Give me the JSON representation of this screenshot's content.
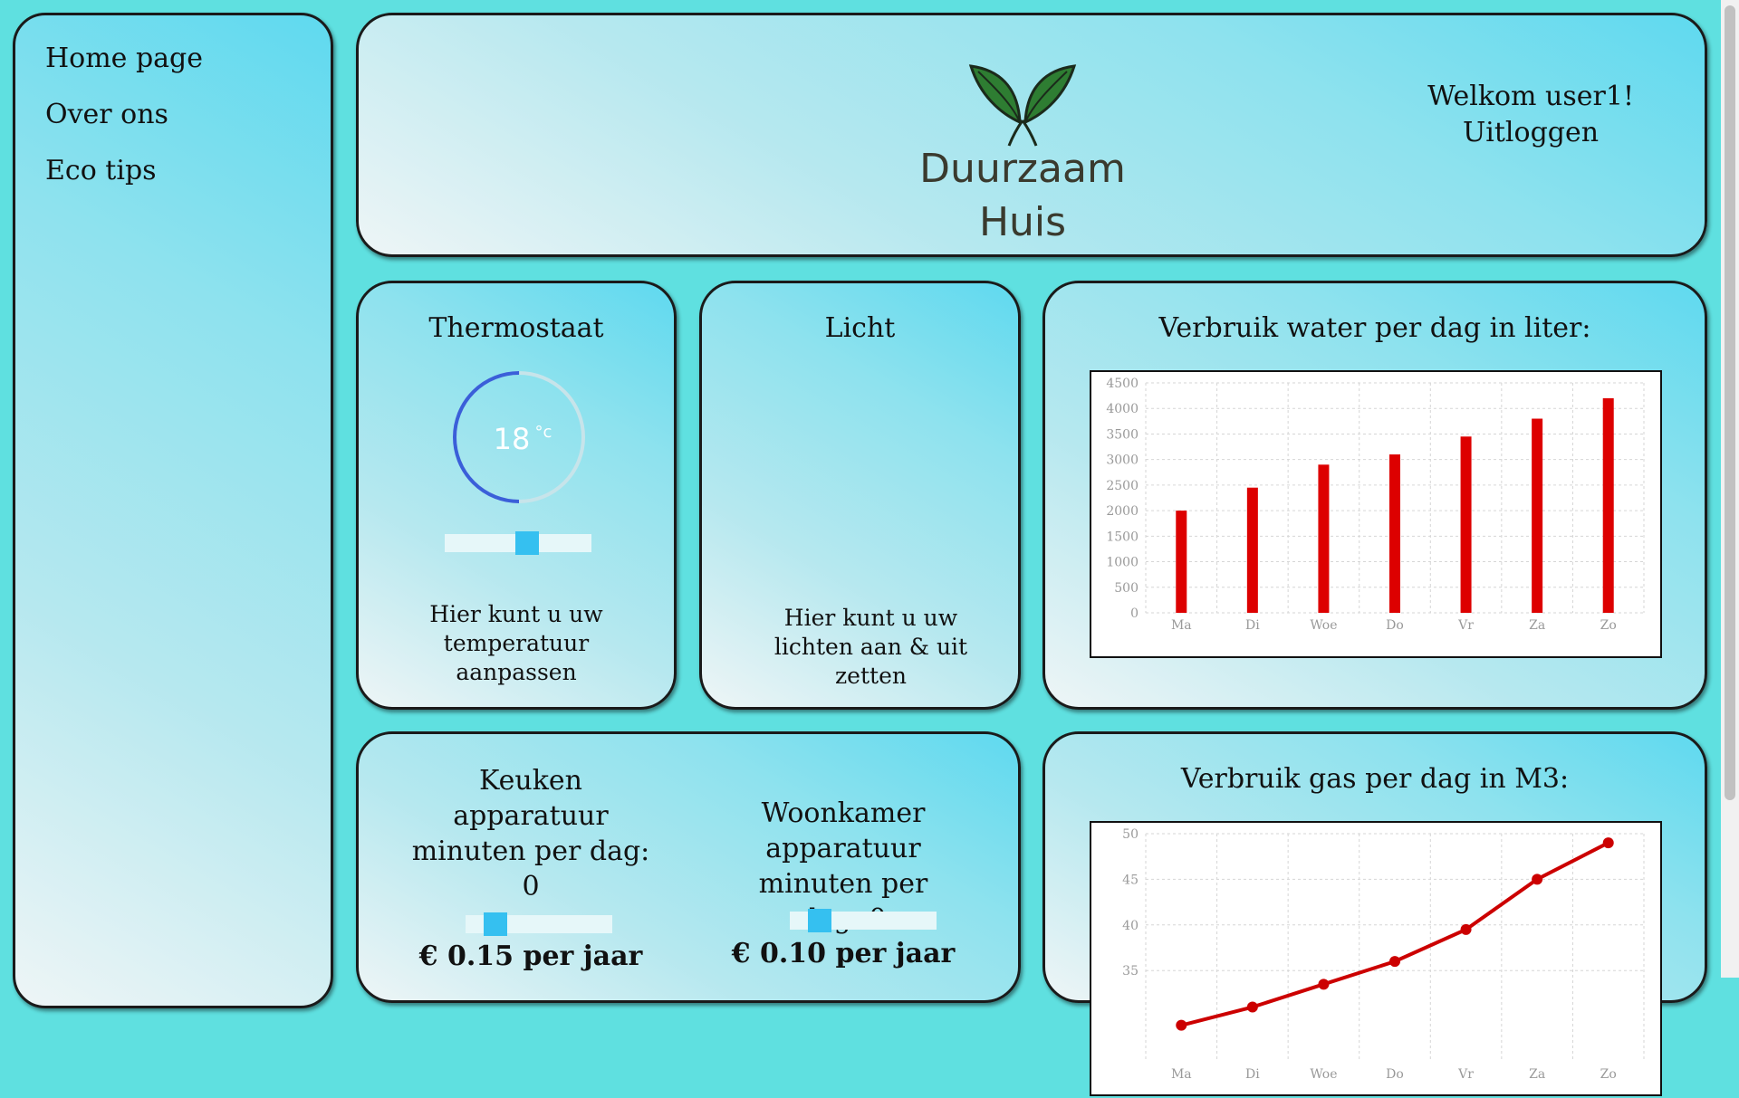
{
  "sidebar": {
    "items": [
      {
        "label": "Home page"
      },
      {
        "label": "Over ons"
      },
      {
        "label": "Eco tips"
      }
    ]
  },
  "header": {
    "logo_line1": "Duurzaam",
    "logo_line2": "Huis",
    "welcome": "Welkom user1!",
    "logout": "Uitloggen"
  },
  "thermostat": {
    "title": "Thermostaat",
    "temperature": "18",
    "unit": "°c",
    "description": "Hier kunt u uw temperatuur aanpassen",
    "slider_fraction": 0.57,
    "dial_fraction": 0.5
  },
  "licht": {
    "title": "Licht",
    "description": "Hier kunt u uw lichten aan & uit zetten"
  },
  "water_chart": {
    "title": "Verbruik water per dag in liter:"
  },
  "gas_chart": {
    "title": "Verbruik gas per dag in M3:"
  },
  "devices": {
    "keuken": {
      "title": "Keuken apparatuur minuten per dag: 0",
      "cost": "€ 0.15 per jaar",
      "slider_fraction": 0.15
    },
    "woonkamer": {
      "title": "Woonkamer apparatuur minuten per dag: 0",
      "cost": "€ 0.10 per jaar",
      "slider_fraction": 0.15
    }
  },
  "colors": {
    "bar": "#dd0000",
    "line": "#cc0000",
    "dial": "#3a5fd9",
    "slider_thumb": "#35c0f0"
  },
  "chart_data": [
    {
      "type": "bar",
      "title": "Verbruik water per dag in liter:",
      "categories": [
        "Ma",
        "Di",
        "Woe",
        "Do",
        "Vr",
        "Za",
        "Zo"
      ],
      "values": [
        2000,
        2450,
        2900,
        3100,
        3450,
        3800,
        4200
      ],
      "ylim": [
        0,
        4500
      ],
      "yticks": [
        0,
        500,
        1000,
        1500,
        2000,
        2500,
        3000,
        3500,
        4000,
        4500
      ],
      "grid": true
    },
    {
      "type": "line",
      "title": "Verbruik gas per dag in M3:",
      "categories": [
        "Ma",
        "Di",
        "Woe",
        "Do",
        "Vr",
        "Za",
        "Zo"
      ],
      "values": [
        29,
        31,
        33.5,
        36,
        39.5,
        45,
        49
      ],
      "ylim": [
        25,
        50
      ],
      "yticks": [
        35,
        40,
        45,
        50
      ],
      "grid": true
    }
  ]
}
